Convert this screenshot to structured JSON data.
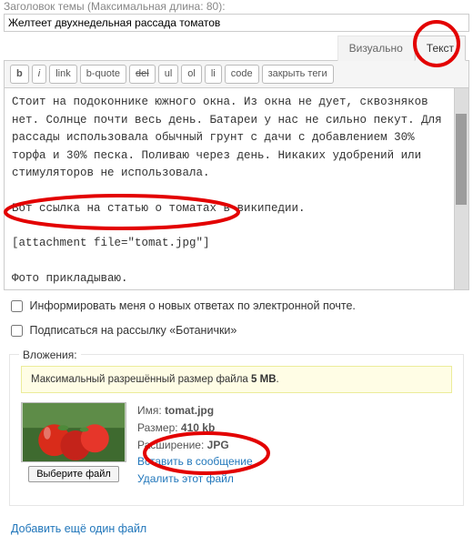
{
  "title_section": {
    "label": "Заголовок темы (Максимальная длина: 80):",
    "value": "Желтеет двухнедельная рассада томатов"
  },
  "tabs": {
    "visual": "Визуально",
    "text": "Текст"
  },
  "toolbar": {
    "b": "b",
    "i": "i",
    "link": "link",
    "bquote": "b-quote",
    "del": "del",
    "ul": "ul",
    "ol": "ol",
    "li": "li",
    "code": "code",
    "close": "закрыть теги"
  },
  "editor": {
    "content": "Стоит на подоконнике южного окна. Из окна не дует, сквозняков нет. Солнце почти весь день. Батареи у нас не сильно пекут. Для рассады использовала обычный грунт с дачи с добавлением 30% торфа и 30% песка. Поливаю через день. Никаких удобрений или стимуляторов не использовала.\n\nВот ссылка на статью о томатах в википедии.\n\n[attachment file=\"tomat.jpg\"]\n\nФото прикладываю."
  },
  "checks": {
    "notify": "Информировать меня о новых ответах по электронной почте.",
    "subscribe": "Подписаться на рассылку «Ботанички»"
  },
  "attachments": {
    "legend": "Вложения:",
    "max_size_prefix": "Максимальный разрешённый размер файла ",
    "max_size_value": "5 MB",
    "choose_file": "Выберите файл",
    "file": {
      "name_label": "Имя:",
      "name": "tomat.jpg",
      "size_label": "Размер:",
      "size": "410 kb",
      "ext_label": "Расширение:",
      "ext": "JPG",
      "insert": "Вставить в сообщение",
      "delete": "Удалить этот файл"
    },
    "add_more": "Добавить ещё один файл"
  }
}
